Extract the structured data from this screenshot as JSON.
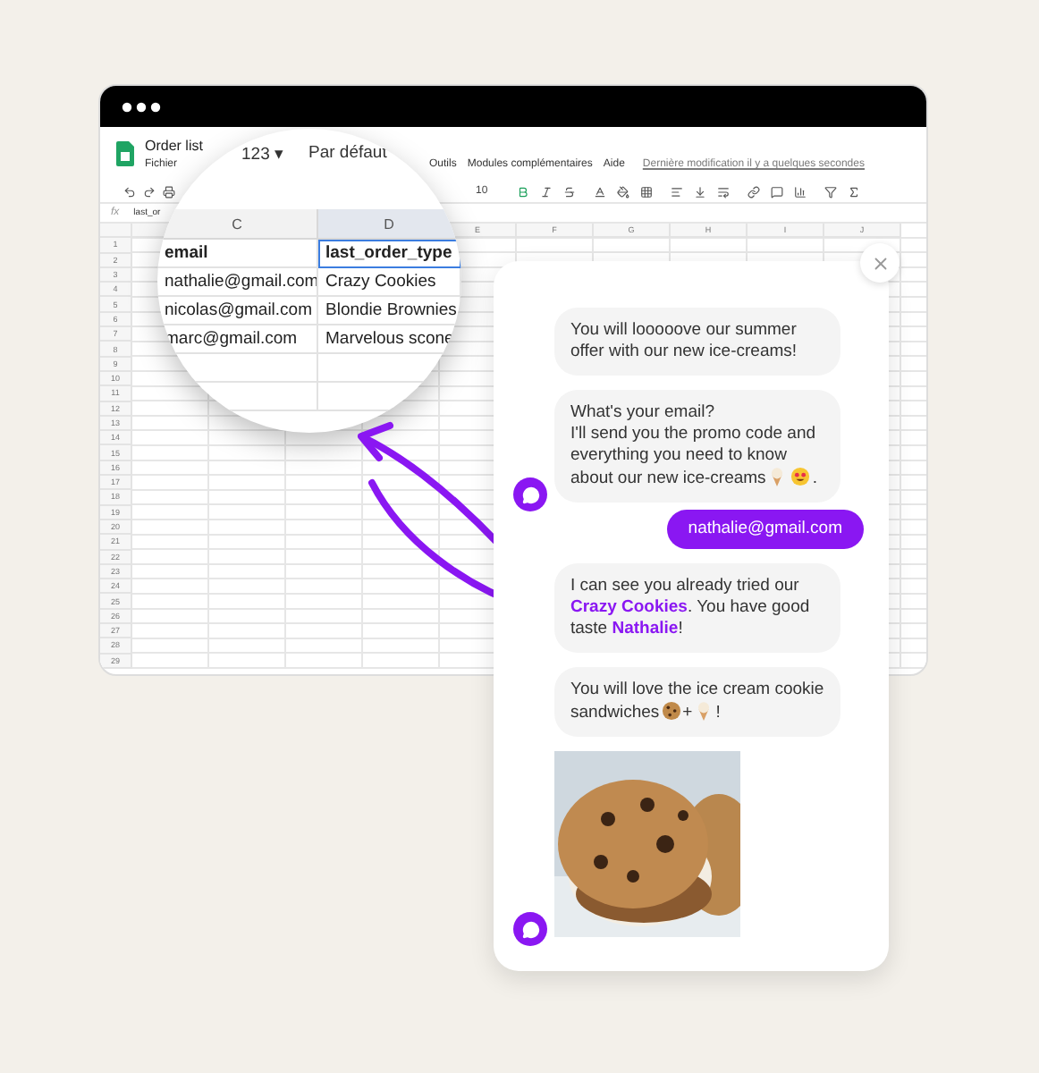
{
  "spreadsheet": {
    "title": "Order list",
    "menu": [
      "Fichier",
      "Outils",
      "Modules complémentaires",
      "Aide"
    ],
    "last_edit": "Dernière modification il y a quelques secondes",
    "font_size": "10",
    "formula_label": "fx",
    "formula": "last_or",
    "columns": [
      "E",
      "F",
      "G",
      "H",
      "I",
      "J"
    ],
    "row_numbers": [
      "1",
      "2",
      "3",
      "4",
      "5",
      "6",
      "7",
      "8",
      "9",
      "10",
      "11",
      "12",
      "13",
      "14",
      "15",
      "16",
      "17",
      "18",
      "19",
      "20",
      "21",
      "22",
      "23",
      "24",
      "25",
      "26",
      "27",
      "28",
      "29"
    ],
    "magnifier": {
      "number_format": "123 ▾",
      "font": "Par défaut",
      "columns": [
        "C",
        "D"
      ],
      "rows": [
        [
          "email",
          "last_order_type"
        ],
        [
          "nathalie@gmail.com",
          "Crazy Cookies"
        ],
        [
          "nicolas@gmail.com",
          "Blondie Brownies"
        ],
        [
          "marc@gmail.com",
          "Marvelous scone"
        ]
      ]
    }
  },
  "chat": {
    "messages": [
      {
        "kind": "bot",
        "parts": [
          {
            "kind": "text",
            "text": "You will looooove our summer offer with our new ice-creams!"
          }
        ]
      },
      {
        "kind": "bot",
        "parts": [
          {
            "kind": "text",
            "text": "What's your email?\nI'll send you the promo code and everything you need to know about our new ice-creams"
          },
          {
            "kind": "icon"
          },
          {
            "kind": "icon"
          },
          {
            "kind": "text",
            "text": "."
          }
        ]
      },
      {
        "kind": "user",
        "parts": [
          {
            "kind": "text",
            "text": "nathalie@gmail.com"
          }
        ]
      },
      {
        "kind": "bot",
        "parts": [
          {
            "kind": "text",
            "text": "I can see you already tried our **Crazy Cookies**. You have good taste **Nathalie**!"
          }
        ]
      },
      {
        "kind": "bot",
        "parts": [
          {
            "kind": "text",
            "text": "You will love the ice cream cookie sandwiches"
          },
          {
            "kind": "icon"
          },
          {
            "kind": "text",
            "text": "+"
          },
          {
            "kind": "icon"
          },
          {
            "kind": "text",
            "text": "!"
          }
        ]
      },
      {
        "kind": "picture"
      }
    ]
  }
}
